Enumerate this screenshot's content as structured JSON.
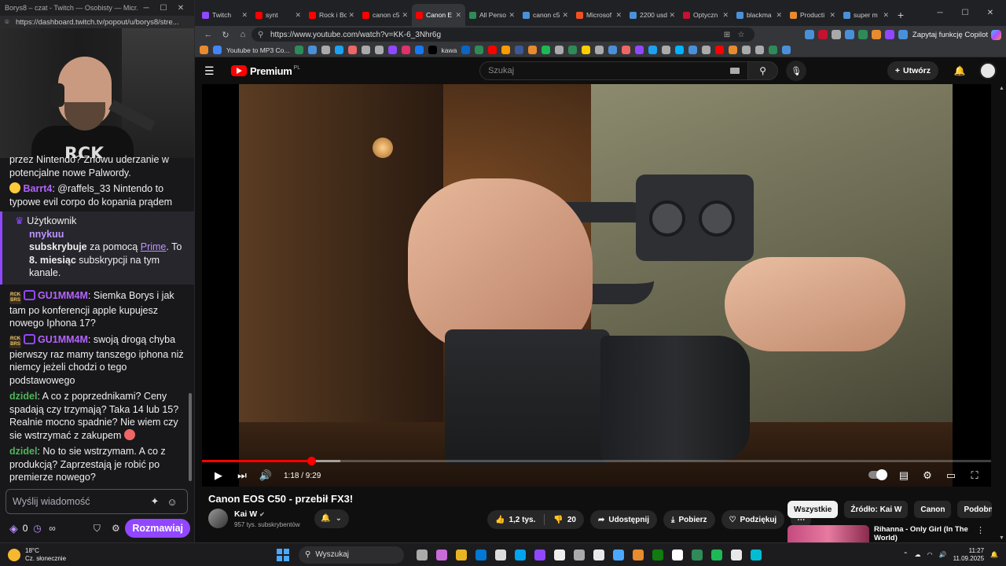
{
  "twitch": {
    "window_title": "Borys8 – czat - Twitch — Osobisty — Micr...",
    "url": "https://dashboard.twitch.tv/popout/u/borys8/stre...",
    "chat": [
      {
        "text": "przez Nintendo? Znowu uderzanie w potencjalne nowe Palwordy."
      },
      {
        "user": "Barrt4",
        "text": ": @raffels_33 Nintendo to typowe evil corpo do kopania prądem"
      },
      {
        "user": "GU1MM4M",
        "text": ": Siemka Borys i jak tam po konferencji apple kupujesz nowego Iphona 17?"
      },
      {
        "user": "GU1MM4M",
        "text": ": swoją drogą chyba pierwszy raz mamy tanszego iphona niż niemcy jeżeli chodzi o tego podstawowego"
      },
      {
        "user": "dzidel",
        "text": ": A co z poprzednikami? Ceny spadają czy trzymają? Taka 14 lub 15? Realnie mocno spadnie? Nie wiem czy sie wstrzymać z zakupem"
      },
      {
        "user": "dzidel",
        "text": ": No to sie wstrzymam. A co z produkcją? Zaprzestają je robić po premierze nowego?"
      }
    ],
    "sub": {
      "label": "Użytkownik",
      "name": "nnykuu",
      "line_a": "subskrybuje",
      "line_b": " za pomocą ",
      "prime": "Prime",
      "line_c": ". To ",
      "months": "8. miesiąc",
      "line_d": " subskrypcji na tym kanale."
    },
    "input_placeholder": "Wyślij wiadomość",
    "points": "0",
    "send_label": "Rozmawiaj",
    "webcam_shirt": "RCK"
  },
  "browser": {
    "tabs": [
      {
        "label": "Twitch",
        "color": "#9147ff"
      },
      {
        "label": "synt",
        "color": "#ff0000"
      },
      {
        "label": "Rock i Bo",
        "color": "#ff0000"
      },
      {
        "label": "canon c5",
        "color": "#ff0000"
      },
      {
        "label": "Canon E",
        "color": "#ff0000",
        "active": true
      },
      {
        "label": "All Perso",
        "color": "#2e8b57"
      },
      {
        "label": "canon c5",
        "color": "#4a90d9"
      },
      {
        "label": "Microsof",
        "color": "#f25022"
      },
      {
        "label": "2200 usd",
        "color": "#4a90d9"
      },
      {
        "label": "Optyczn",
        "color": "#c4122f"
      },
      {
        "label": "blackma",
        "color": "#4a90d9"
      },
      {
        "label": "Producti",
        "color": "#e88b2e"
      },
      {
        "label": "super m",
        "color": "#4a90d9"
      }
    ],
    "url": "https://www.youtube.com/watch?v=KK-6_3Nhr6g",
    "copilot_label": "Zapytaj funkcję Copilot",
    "bookmark_label": "Youtube to MP3 Co...",
    "bookmark_kawa": "kawa",
    "ext_colors": [
      "#4a90d9",
      "#c4122f",
      "#aaaaaa",
      "#4a90d9",
      "#2e8b57",
      "#e88b2e",
      "#9147ff",
      "#4a90d9"
    ],
    "bookmark_colors": [
      "#e88b2e",
      "#4285f4",
      "#2e8b57",
      "#4a90d9",
      "#aaaaaa",
      "#1da1f2",
      "#e66",
      "#aaaaaa",
      "#aaaaaa",
      "#9147ff",
      "#e1306c",
      "#1877f2",
      "#000000",
      "#0a66c2",
      "#2e8b57",
      "#ff0000",
      "#ff9900",
      "#3b5998",
      "#e88b2e",
      "#1db954",
      "#aaaaaa",
      "#2e8b57",
      "#ffcc00",
      "#aaaaaa",
      "#4a90d9",
      "#e66",
      "#9147ff",
      "#1da1f2",
      "#aaaaaa",
      "#00b2ff",
      "#4a90d9",
      "#aaaaaa",
      "#ff0000",
      "#e88b2e",
      "#aaaaaa",
      "#aaaaaa",
      "#2e8b57",
      "#4a90d9"
    ]
  },
  "youtube": {
    "brand": "Premium",
    "brand_suffix": "PL",
    "search_placeholder": "Szukaj",
    "create_label": "Utwórz",
    "time": "1:18 / 9:29",
    "progress_fraction": 0.138,
    "buffered_fraction": 0.175,
    "video_title": "Canon EOS C50 - przebił FX3!",
    "channel": "Kai W",
    "subscribers": "957 tys. subskrybentów",
    "likes": "1,2 tys.",
    "dislikes": "20",
    "share_label": "Udostępnij",
    "download_label": "Pobierz",
    "thanks_label": "Podziękuj",
    "chips": [
      "Wszystkie",
      "Źródło: Kai W",
      "Canon",
      "Podobne"
    ],
    "rec_title": "Rihanna - Only Girl (In The World)"
  },
  "taskbar": {
    "temp": "18°C",
    "weather": "Cz. słonecznie",
    "search_placeholder": "Wyszukaj",
    "time": "11:27",
    "date": "11.09.2025",
    "app_colors": [
      "#aaaaaa",
      "#c96bd8",
      "#e8b422",
      "#0078d4",
      "#ddd",
      "#00a4ef",
      "#9147ff",
      "#eee",
      "#aaa",
      "#e8e8e8",
      "#4aa8ff",
      "#e88b2e",
      "#107c10",
      "#ffffff",
      "#2e8b57",
      "#1db954",
      "#e8e8e8",
      "#00bcd4"
    ]
  }
}
